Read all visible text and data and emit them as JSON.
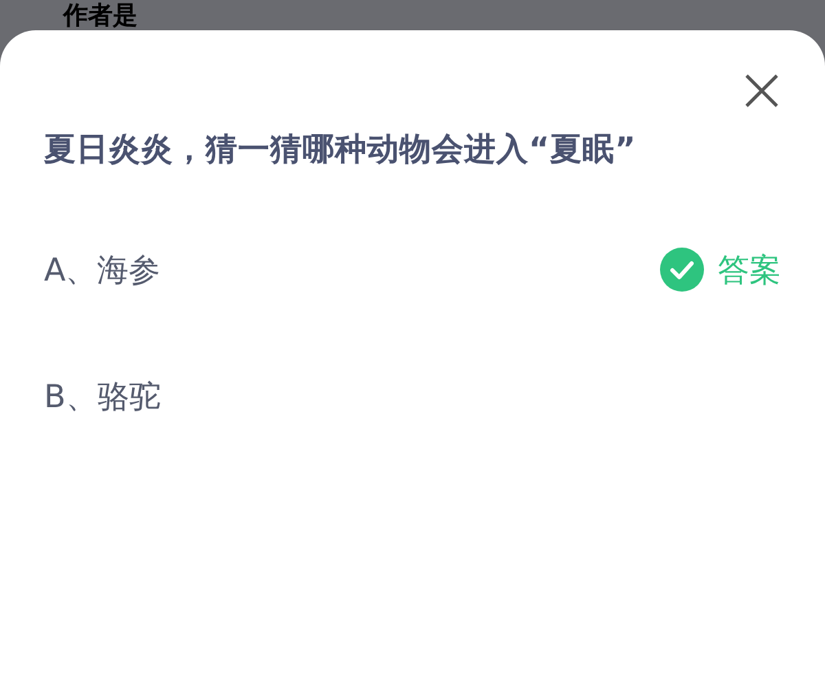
{
  "background_text": "作者是",
  "question": "夏日炎炎，猜一猜哪种动物会进入“夏眠”",
  "options": [
    {
      "label": "A、海参",
      "correct": true,
      "answer_label": "答案"
    },
    {
      "label": "B、骆驼",
      "correct": false
    }
  ]
}
